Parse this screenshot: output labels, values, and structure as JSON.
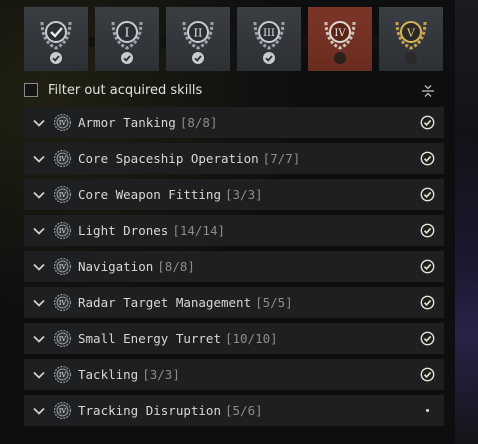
{
  "tiers": [
    {
      "label": "",
      "status": "done"
    },
    {
      "label": "I",
      "status": "done"
    },
    {
      "label": "II",
      "status": "done"
    },
    {
      "label": "III",
      "status": "done"
    },
    {
      "label": "IV",
      "status": "current"
    },
    {
      "label": "V",
      "status": "locked"
    }
  ],
  "filter": {
    "label": "Filter out acquired skills",
    "checked": false
  },
  "skill_level_badge": "IV",
  "skills": [
    {
      "name": "Armor Tanking",
      "count": "[8/8]",
      "complete": true
    },
    {
      "name": "Core Spaceship Operation",
      "count": "[7/7]",
      "complete": true
    },
    {
      "name": "Core Weapon Fitting",
      "count": "[3/3]",
      "complete": true
    },
    {
      "name": "Light Drones",
      "count": "[14/14]",
      "complete": true
    },
    {
      "name": "Navigation",
      "count": "[8/8]",
      "complete": true
    },
    {
      "name": "Radar Target Management",
      "count": "[5/5]",
      "complete": true
    },
    {
      "name": "Small Energy Turret",
      "count": "[10/10]",
      "complete": true
    },
    {
      "name": "Tackling",
      "count": "[3/3]",
      "complete": true
    },
    {
      "name": "Tracking Disruption",
      "count": "[5/6]",
      "complete": false
    }
  ],
  "colors": {
    "tier_bg": "#34373b",
    "tier_active_bg": "#73301f",
    "row_bg": "#1d1f21",
    "check_color": "#e4e8cf",
    "gold": "#c8a24a"
  }
}
